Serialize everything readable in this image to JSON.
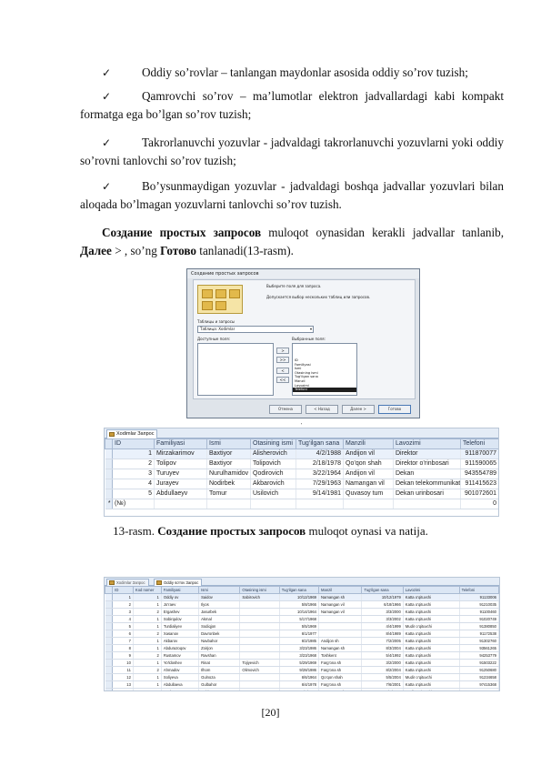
{
  "bullets": [
    {
      "icon": "checkmark-icon",
      "text": "Oddiy so’rovlar – tanlangan maydonlar asosida oddiy so’rov tuzish;"
    },
    {
      "icon": "checkmark-icon",
      "text": "Qamrovchi so’rov – ma’lumotlar elektron jadvallardagi kabi kompakt formatga ega bo’lgan so’rov tuzish;"
    },
    {
      "icon": "checkmark-icon",
      "text": "Takrorlanuvchi yozuvlar - jadvaldagi takrorlanuvchi yozuvlarni yoki oddiy so’rovni tanlovchi so’rov tuzish;"
    },
    {
      "icon": "checkmark-icon",
      "text": "Bo’ysunmaydigan yozuvlar - jadvaldagi boshqa jadvallar yozuvlari bilan aloqada bo’lmagan yozuvlarni tanlovchi so’rov tuzish."
    }
  ],
  "instruction": {
    "bold1": "Создание простых запросов",
    "text1": " muloqot oynasidan kerakli jadvallar tanlanib, ",
    "bold2": "Далее",
    "text2": " > , so’ng ",
    "bold3": "Готово",
    "text3": " tanlanadi(13-rasm)."
  },
  "dialog": {
    "title": "Создание простых запросов",
    "heading": "Выберите поля для запроса.",
    "subheading": "Допускается выбор нескольких таблиц или запросов.",
    "tables_label": "Таблицы и запросы",
    "tables_value": "Таблица: Xodimlar",
    "available_label": "Доступные поля:",
    "selected_label": "Выбранные поля:",
    "selected_fields": [
      "ID",
      "Familiyasi",
      "Ismi",
      "Otasining ismi",
      "Tug‘ilgan sana",
      "Manzil",
      "Lavozimi",
      "Telefoni"
    ],
    "move_buttons": [
      ">",
      ">>",
      "<",
      "<<"
    ],
    "footer_buttons": [
      "Отмена",
      "< Назад",
      "Далее >",
      "Готово"
    ]
  },
  "table1": {
    "tab": "Xodimlar Запрос",
    "columns": [
      "ID",
      "Familiyasi",
      "Ismi",
      "Otasining ismi",
      "Tug‘ilgan sana",
      "Manzili",
      "Lavozimi",
      "Telefoni"
    ],
    "rows": [
      [
        "1",
        "Mirzakarimov",
        "Baxtiyor",
        "Alisherovich",
        "4/2/1988",
        "Andijon vil",
        "Direktor",
        "911870077"
      ],
      [
        "2",
        "Tolipov",
        "Baxtiyor",
        "Tolipovich",
        "2/18/1978",
        "Qo’qon shah",
        "Direktor o’rinbosari",
        "911590065"
      ],
      [
        "3",
        "Turuyev",
        "Nurulhamidov",
        "Qodirovich",
        "3/22/1964",
        "Andijon vil",
        "Dekan",
        "943554789"
      ],
      [
        "4",
        "Jurayev",
        "Nodirbek",
        "Akbarovich",
        "7/29/1963",
        "Namangan vil",
        "Dekan telekommunikat",
        "911415623"
      ],
      [
        "5",
        "Abdullaeyv",
        "Tomur",
        "Usilovich",
        "9/14/1981",
        "Quvasoy tum",
        "Dekan urinbosari",
        "901072601"
      ]
    ],
    "new_row_marker": "*",
    "new_row_label": "(№)",
    "new_row_value": "0"
  },
  "caption": {
    "prefix": "13-rasm. ",
    "bold": "Создание простых запросов",
    "suffix": " muloqot oynasi va natija."
  },
  "table2": {
    "tabs": [
      "Xodimlar Запрос",
      "Oddiy so’rov Запрос"
    ],
    "columns": [
      "ID",
      "Kod nomer",
      "Familiyasi",
      "Ismi",
      "Otasining ismi",
      "Tug‘ilgan sana",
      "Manzil",
      "Tug‘ilgan sana",
      "Lavozimi",
      "Telefoni"
    ],
    "rows": [
      [
        "1",
        "1",
        "Oddiy ov",
        "Saidov",
        "Sabirovich",
        "10/12/1969",
        "Namangan sh",
        "10/12/1979",
        "Katta o’qituvchi",
        "91133006"
      ],
      [
        "2",
        "1",
        "Jo’raev",
        "Ilyos",
        "",
        "5/8/1966",
        "Namangan vil",
        "6/18/1966",
        "Katta o’qituvchi",
        "91210035"
      ],
      [
        "3",
        "2",
        "Ergashev",
        "Jasurbek",
        "",
        "10/14/1964",
        "Namangan vil",
        "3/3/2000",
        "Katta o’qituvchi",
        "91100460"
      ],
      [
        "4",
        "1",
        "Sobirqulov",
        "Akmal",
        "",
        "5/17/1968",
        "",
        "3/3/2002",
        "Katta o’qituvchi",
        "91020749"
      ],
      [
        "5",
        "1",
        "Turdialiyev",
        "Sodiqjon",
        "",
        "5/5/1969",
        "",
        "4/4/1999",
        "Mudir o’qituvchi",
        "91380850"
      ],
      [
        "6",
        "2",
        "Xasanov",
        "Davronbek",
        "",
        "6/1/1977",
        "",
        "8/4/1989",
        "Katta o’qituvchi",
        "91172538"
      ],
      [
        "7",
        "1",
        "Akbarov",
        "Navbahor",
        "",
        "6/2/1985",
        "Andijon sh",
        "7/2/2005",
        "Katta o’qituvchi",
        "91302760"
      ],
      [
        "8",
        "1",
        "Abdurazoqov",
        "Zoirjon",
        "",
        "3/23/1986",
        "Namangan sh",
        "8/3/2004",
        "Katta o’qituvchi",
        "93561265"
      ],
      [
        "9",
        "2",
        "Rustamov",
        "Ravshan",
        "",
        "3/23/1968",
        "Toshkent",
        "5/4/1992",
        "Katta o’qituvchi",
        "94253779"
      ],
      [
        "10",
        "1",
        "Yo’ldoshev",
        "Rinat",
        "Tojiyevich",
        "5/29/1969",
        "Farg’ona sh",
        "3/2/2000",
        "Katta o’qituvchi",
        "91503222"
      ],
      [
        "11",
        "2",
        "Ahmadov",
        "Ilhom",
        "Olimovich",
        "9/28/1986",
        "Farg’ona sh",
        "8/2/2004",
        "Katta o’qituvchi",
        "91250680"
      ],
      [
        "12",
        "1",
        "Soliyeva",
        "Gulnoza",
        "",
        "6/6/1964",
        "Qo’qon shah",
        "5/5/2004",
        "Mudir o’qituvchi",
        "91234658"
      ],
      [
        "13",
        "1",
        "Abdullaeva",
        "Gulbahor",
        "",
        "6/4/1978",
        "Farg’ona sh",
        "7/6/2001",
        "Katta o’qituvchi",
        "97415368"
      ],
      [
        "14",
        "1",
        "Qurbonov",
        "Saidxon",
        "",
        "6/5/1975",
        "Namangan sh",
        "7/6/2002",
        "Mudir o’qituvchi",
        "91502488"
      ]
    ]
  },
  "page_number": "[20]",
  "colors": {
    "header_bg": "#dbe6f4",
    "tab_bg": "#e4ecf6",
    "selection": "#1e1e1e"
  }
}
